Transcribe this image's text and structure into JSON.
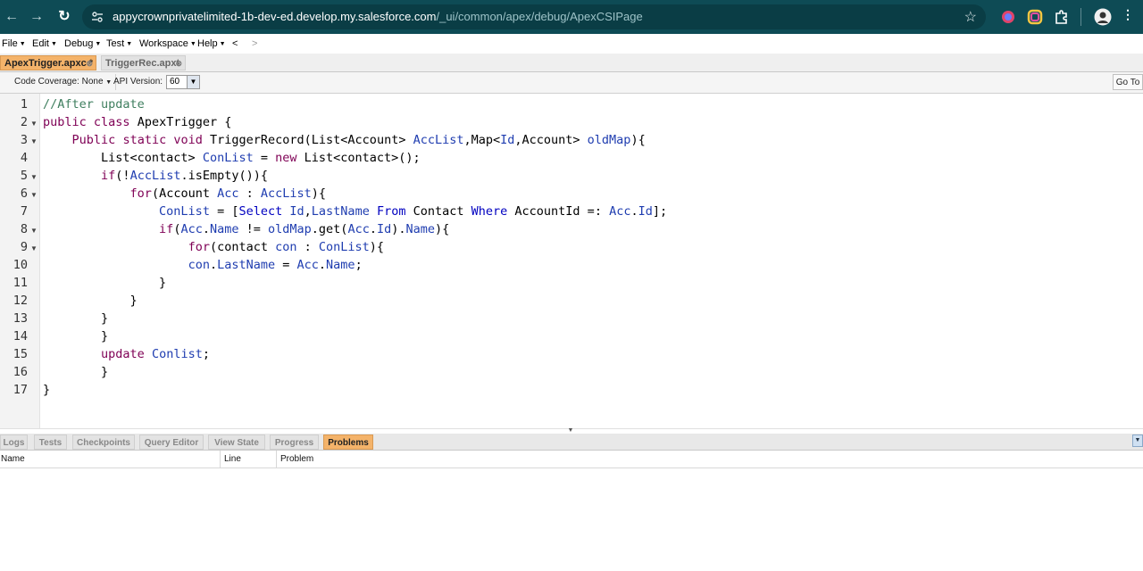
{
  "browser": {
    "url_host": "appycrownprivatelimited-1b-dev-ed.develop.my.salesforce.com",
    "url_path": "/_ui/common/apex/debug/ApexCSIPage",
    "back_icon": "back-arrow-icon",
    "forward_icon": "forward-arrow-icon",
    "reload_icon": "reload-icon"
  },
  "menu": {
    "items": [
      "File",
      "Edit",
      "Debug",
      "Test",
      "Workspace",
      "Help"
    ],
    "nav_back": "<",
    "nav_forward": ">"
  },
  "tabs": [
    {
      "label": "ApexTrigger.apxc *",
      "active": true
    },
    {
      "label": "TriggerRec.apxt",
      "active": false
    }
  ],
  "toolbar": {
    "coverage": "Code Coverage: None",
    "api_label": "API Version:",
    "api_value": "60",
    "goto": "Go To"
  },
  "editor": {
    "lines": [
      "//After update",
      "public class ApexTrigger {",
      "    Public static void TriggerRecord(List<Account> AccList,Map<Id,Account> oldMap){",
      "        List<contact> ConList = new List<contact>();",
      "        if(!AccList.isEmpty()){",
      "            for(Account Acc : AccList){",
      "                ConList = [Select Id,LastName From Contact Where AccountId =: Acc.Id];",
      "                if(Acc.Name != oldMap.get(Acc.Id).Name){",
      "                    for(contact con : ConList){",
      "                    con.LastName = Acc.Name;",
      "                }",
      "            }",
      "        }",
      "        }",
      "        update Conlist;",
      "        }",
      "}"
    ],
    "line_numbers": [
      "1",
      "2",
      "3",
      "4",
      "5",
      "6",
      "7",
      "8",
      "9",
      "10",
      "11",
      "12",
      "13",
      "14",
      "15",
      "16",
      "17"
    ]
  },
  "bottom_tabs": [
    "Logs",
    "Tests",
    "Checkpoints",
    "Query Editor",
    "View State",
    "Progress",
    "Problems"
  ],
  "problems": {
    "columns": [
      "Name",
      "Line",
      "Problem"
    ]
  }
}
